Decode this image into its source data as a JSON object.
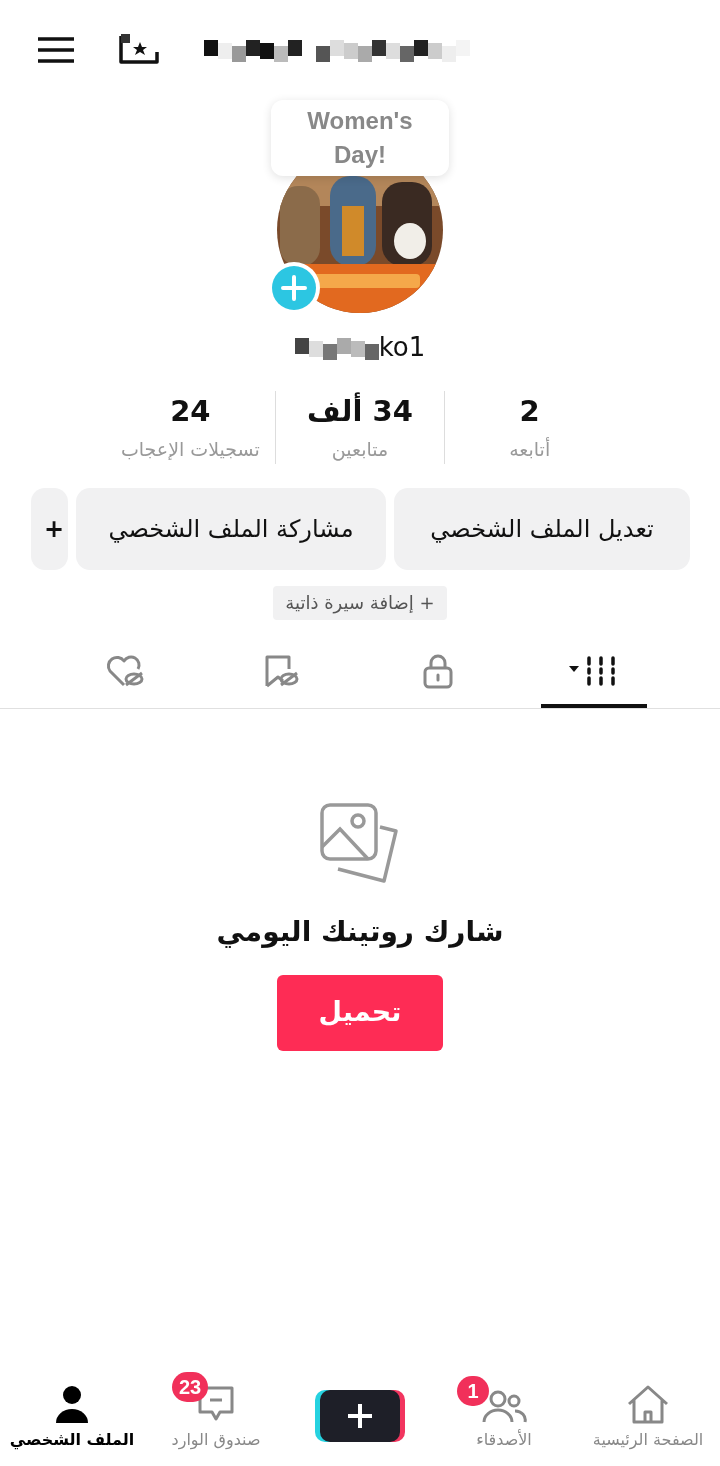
{
  "tooltip": {
    "text": "Women's Day!"
  },
  "profile": {
    "username_visible": "ko1"
  },
  "stats": [
    {
      "value": "2",
      "label": "أتابعه"
    },
    {
      "value": "34 ألف",
      "label": "متابعين"
    },
    {
      "value": "24",
      "label": "تسجيلات الإعجاب"
    }
  ],
  "actions": [
    {
      "label": "تعديل الملف الشخصي"
    },
    {
      "label": "مشاركة الملف الشخصي"
    },
    {
      "label": "+"
    }
  ],
  "bio_button": {
    "label": "+ إضافة سيرة ذاتية"
  },
  "tabs": [
    {
      "kind": "videos",
      "selected": true
    },
    {
      "kind": "private",
      "selected": false
    },
    {
      "kind": "saved",
      "selected": false
    },
    {
      "kind": "liked",
      "selected": false
    }
  ],
  "empty_state": {
    "title": "شارك روتينك اليومي",
    "button": "تحميل"
  },
  "nav": [
    {
      "kind": "home",
      "label": "الصفحة الرئيسية",
      "selected": false
    },
    {
      "kind": "friends",
      "label": "الأصدقاء",
      "badge": "1",
      "selected": false
    },
    {
      "kind": "create",
      "selected": false
    },
    {
      "kind": "inbox",
      "label": "صندوق الوارد",
      "badge": "23",
      "selected": false
    },
    {
      "kind": "profile",
      "label": "الملف الشخصي",
      "selected": true
    }
  ]
}
